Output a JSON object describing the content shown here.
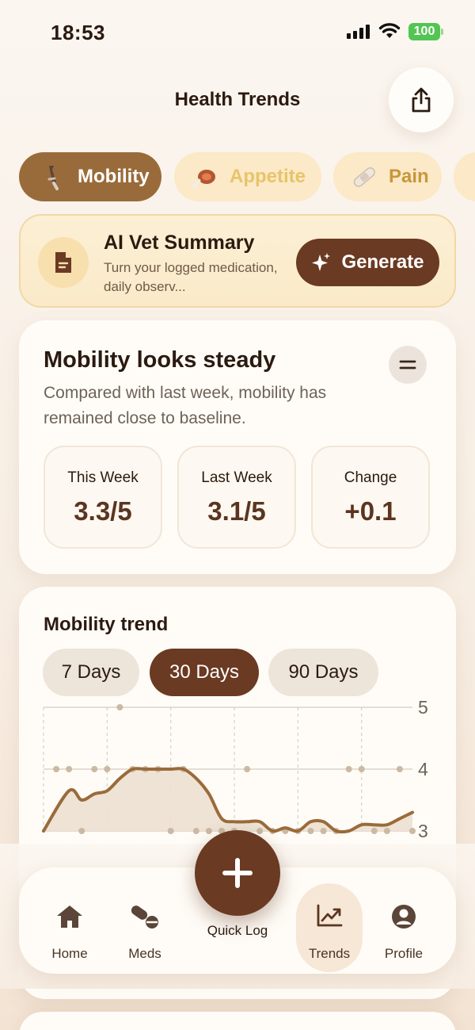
{
  "status": {
    "time": "18:53",
    "battery": "100"
  },
  "header": {
    "title": "Health Trends"
  },
  "chips": [
    {
      "label": "Mobility",
      "icon": "crutch-icon"
    },
    {
      "label": "Appetite",
      "icon": "meat-icon"
    },
    {
      "label": "Pain",
      "icon": "bandage-icon"
    }
  ],
  "ai_card": {
    "title": "AI Vet Summary",
    "subtitle": "Turn your logged medication, daily observ...",
    "button": "Generate"
  },
  "summary": {
    "title": "Mobility looks steady",
    "description": "Compared with last week, mobility has remained close to baseline.",
    "stats": [
      {
        "label": "This Week",
        "value": "3.3/5"
      },
      {
        "label": "Last Week",
        "value": "3.1/5"
      },
      {
        "label": "Change",
        "value": "+0.1"
      }
    ]
  },
  "trend": {
    "title": "Mobility trend",
    "ranges": [
      "7 Days",
      "30 Days",
      "90 Days"
    ],
    "selected_range": "30 Days"
  },
  "chart_data": {
    "type": "line",
    "ylim": [
      3,
      5
    ],
    "yticks": [
      "5",
      "4",
      "3"
    ],
    "line_x": [
      0,
      2,
      3,
      4,
      5,
      6,
      7,
      8,
      9,
      10,
      11,
      12,
      13,
      14,
      15,
      16,
      17,
      18,
      19,
      20,
      21,
      22,
      23,
      24,
      25,
      26,
      27,
      28,
      29
    ],
    "line_y": [
      3.0,
      3.65,
      3.5,
      3.6,
      3.65,
      3.85,
      4.0,
      4.0,
      4.0,
      4.0,
      4.0,
      3.85,
      3.6,
      3.2,
      3.15,
      3.15,
      3.15,
      3.0,
      3.05,
      3.0,
      3.15,
      3.15,
      3.0,
      3.0,
      3.1,
      3.1,
      3.1,
      3.2,
      3.3
    ],
    "points_x": [
      1,
      2,
      3,
      4,
      5,
      6,
      7,
      8,
      9,
      10,
      11,
      12,
      13,
      14,
      15,
      16,
      17,
      18,
      19,
      20,
      21,
      22,
      23,
      24,
      25,
      26,
      27,
      28,
      29
    ],
    "points_y": [
      4,
      4,
      3,
      4,
      4,
      5,
      4,
      4,
      4,
      3,
      4,
      3,
      3,
      3,
      3,
      4,
      3,
      3,
      3,
      3,
      3,
      3,
      3,
      4,
      4,
      3,
      3,
      4,
      3
    ],
    "colors": {
      "line": "#9a6b3a",
      "fill": "#ece0d0",
      "dot": "#ccb9a3"
    }
  },
  "nav": {
    "quick_log": "Quick Log",
    "tabs": [
      {
        "label": "Home",
        "icon": "home-icon"
      },
      {
        "label": "Meds",
        "icon": "pills-icon"
      },
      {
        "label": "Trends",
        "icon": "trends-icon"
      },
      {
        "label": "Profile",
        "icon": "profile-icon"
      }
    ],
    "active": "Trends"
  }
}
